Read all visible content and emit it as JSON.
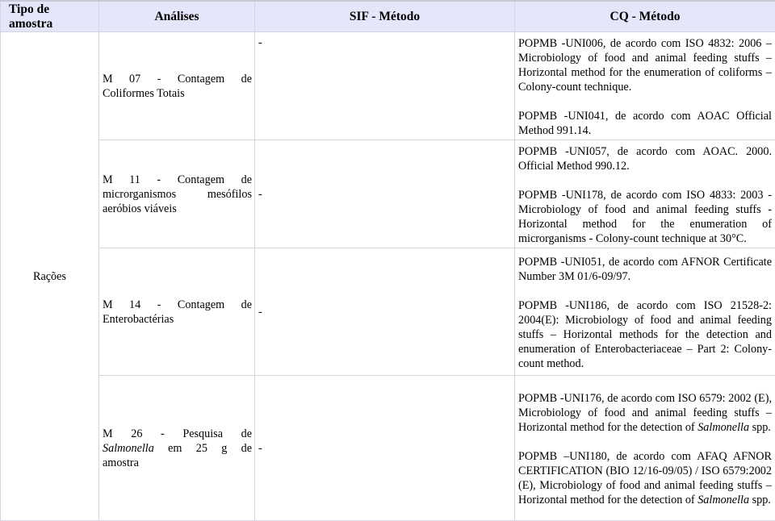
{
  "table": {
    "headers": [
      "Tipo de amostra",
      "Análises",
      "SIF - Método",
      "CQ - Método"
    ],
    "sample_type": "Rações",
    "rows": [
      {
        "analysis": {
          "line1": "M 07 - Contagem de",
          "rest": "Coliformes Totais"
        },
        "sif_method": "-",
        "cq_methods": [
          {
            "text": "POPMB -UNI006, de acordo com ISO 4832: 2006 – Microbiology of food and animal feeding stuffs – Horizontal method for the enumeration of coliforms – Colony-count technique."
          },
          {
            "text": "POPMB -UNI041, de acordo com  AOAC Official Method 991.14."
          }
        ]
      },
      {
        "analysis": {
          "line1": "M 11 - Contagem de",
          "line2": "microrganismos mesófilos",
          "rest": "aeróbios viáveis"
        },
        "sif_method": "-",
        "cq_methods": [
          {
            "text": "POPMB -UNI057, de acordo com AOAC. 2000. Official Method 990.12."
          },
          {
            "text": "POPMB -UNI178, de acordo com ISO 4833: 2003 - Microbiology of food and animal feeding stuffs - Horizontal method for the enumeration of microrganisms - Colony-count technique at 30°C."
          }
        ]
      },
      {
        "analysis": {
          "line1": "M 14 - Contagem de",
          "rest": "Enterobactérias"
        },
        "sif_method": "-",
        "cq_methods": [
          {
            "text": "POPMB -UNI051, de acordo  com AFNOR Certificate Number 3M 01/6-09/97."
          },
          {
            "text": "POPMB -UNI186, de acordo com ISO 21528-2: 2004(E): Microbiology of food and animal feeding stuffs – Horizontal methods for the detection and enumeration of Enterobacteriaceae – Part 2: Colony-count method."
          }
        ]
      },
      {
        "analysis": {
          "line1": "M 26 - Pesquisa de",
          "line2_italic": "Salmonella",
          "line2_rest": " em 25 g de",
          "rest": "amostra"
        },
        "sif_method": "-",
        "cq_methods": [
          {
            "before": "POPMB -UNI176, de acordo com ISO 6579: 2002 (E), Microbiology of food and animal feeding stuffs – Horizontal method for the detection of ",
            "italic": "Salmonella",
            "after": " spp."
          },
          {
            "before": "POPMB –UNI180, de acordo com AFAQ AFNOR CERTIFICATION (BIO 12/16-09/05) / ISO 6579:2002 (E), Microbiology of food and animal feeding stuffs – Horizontal method for the detection of ",
            "italic": "Salmonella",
            "after": " spp."
          }
        ]
      }
    ]
  }
}
